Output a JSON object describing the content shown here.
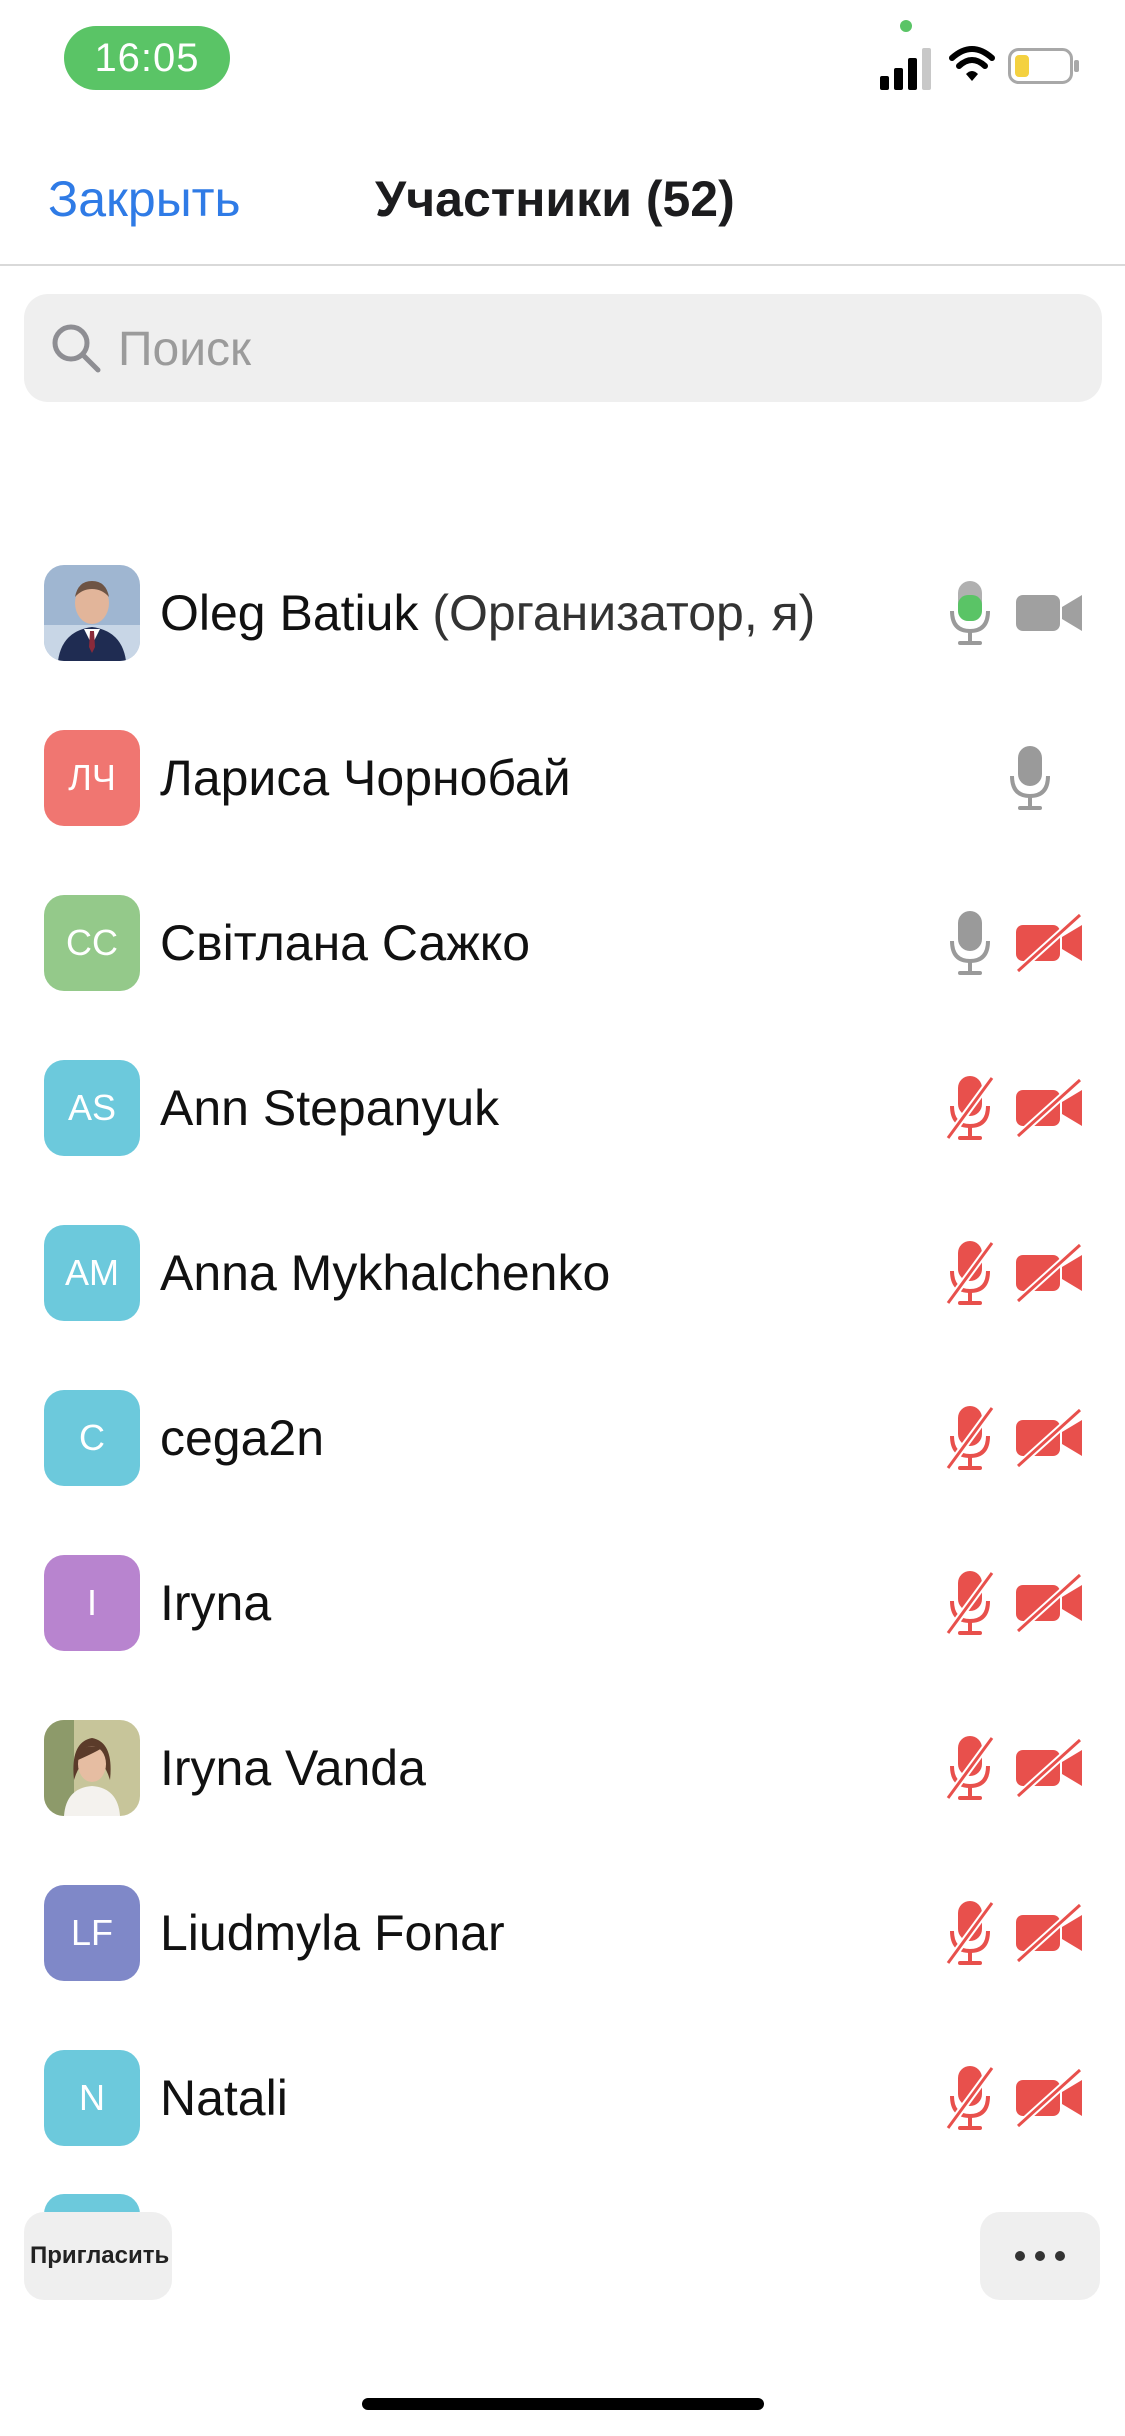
{
  "status_bar": {
    "time": "16:05"
  },
  "header": {
    "close_label": "Закрыть",
    "title": "Участники (52)"
  },
  "search": {
    "placeholder": "Поиск",
    "value": ""
  },
  "colors": {
    "accent": "#2f7be6",
    "mic_active": "#5ac466",
    "muted_red": "#e8504c",
    "icon_gray": "#9a9a9a"
  },
  "participants": [
    {
      "name": "Oleg Batiuk",
      "role": "(Организатор, я)",
      "avatar_type": "photo",
      "avatar_icon": "person-photo-male",
      "mic": "on",
      "video": "on"
    },
    {
      "name": "Лариса Чорнобай",
      "initials": "ЛЧ",
      "avatar_color": "#f07671",
      "mic": "off-unmuted",
      "video": "none"
    },
    {
      "name": "Світлана Сажко",
      "initials": "СС",
      "avatar_color": "#94c98a",
      "mic": "off-unmuted",
      "video": "off"
    },
    {
      "name": "Ann Stepanyuk",
      "initials": "AS",
      "avatar_color": "#6cc9dc",
      "mic": "muted",
      "video": "off"
    },
    {
      "name": "Anna Mykhalchenko",
      "initials": "AM",
      "avatar_color": "#6cc9dc",
      "mic": "muted",
      "video": "off"
    },
    {
      "name": "cega2n",
      "initials": "C",
      "avatar_color": "#6cc9dc",
      "mic": "muted",
      "video": "off"
    },
    {
      "name": "Iryna",
      "initials": "I",
      "avatar_color": "#b884cf",
      "mic": "muted",
      "video": "off"
    },
    {
      "name": "Iryna Vanda",
      "avatar_type": "photo",
      "avatar_icon": "person-photo-female",
      "mic": "muted",
      "video": "off"
    },
    {
      "name": "Liudmyla Fonar",
      "initials": "LF",
      "avatar_color": "#7f88c8",
      "mic": "muted",
      "video": "off"
    },
    {
      "name": "Natali",
      "initials": "N",
      "avatar_color": "#6cc9dc",
      "mic": "muted",
      "video": "off"
    }
  ],
  "bottom_bar": {
    "invite_label": "Пригласить",
    "more_icon": "more-horizontal-icon"
  }
}
